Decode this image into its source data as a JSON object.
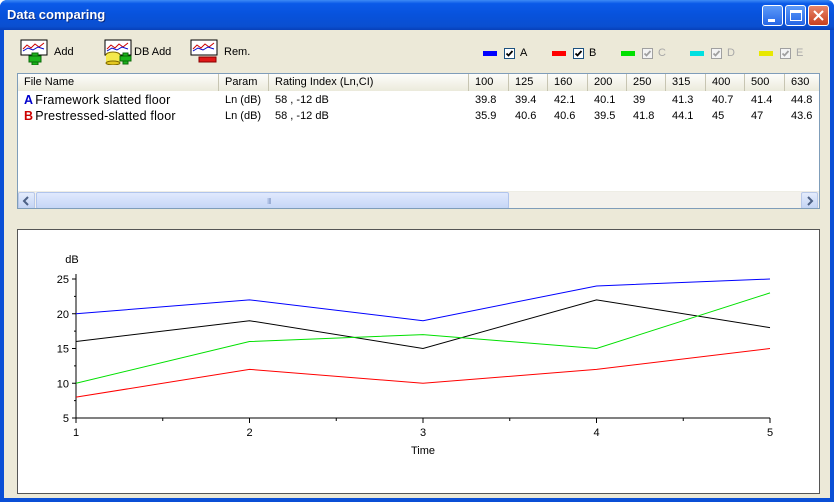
{
  "window": {
    "title": "Data comparing"
  },
  "toolbar": {
    "add_label": "Add",
    "db_add_label": "DB Add",
    "rem_label": "Rem."
  },
  "legend": [
    {
      "letter": "A",
      "color": "#0000ff",
      "checked": true,
      "enabled": true
    },
    {
      "letter": "B",
      "color": "#ff0000",
      "checked": true,
      "enabled": true
    },
    {
      "letter": "C",
      "color": "#00e000",
      "checked": true,
      "enabled": false
    },
    {
      "letter": "D",
      "color": "#00e0e0",
      "checked": true,
      "enabled": false
    },
    {
      "letter": "E",
      "color": "#e8e800",
      "checked": true,
      "enabled": false
    }
  ],
  "table": {
    "columns": [
      "File Name",
      "Param",
      "Rating Index (Ln,CI)",
      "100",
      "125",
      "160",
      "200",
      "250",
      "315",
      "400",
      "500",
      "630"
    ],
    "rows": [
      {
        "letter": "A",
        "letter_color": "#0000cc",
        "name": "Framework slatted floor",
        "param": "Ln (dB)",
        "rating": "58 , -12 dB",
        "values": [
          "39.8",
          "39.4",
          "42.1",
          "40.1",
          "39",
          "41.3",
          "40.7",
          "41.4",
          "44.8"
        ]
      },
      {
        "letter": "B",
        "letter_color": "#cc0000",
        "name": "Prestressed-slatted floor",
        "param": "Ln (dB)",
        "rating": "58 , -12 dB",
        "values": [
          "35.9",
          "40.6",
          "40.6",
          "39.5",
          "41.8",
          "44.1",
          "45",
          "47",
          "43.6"
        ]
      }
    ],
    "scroll_grip": "III"
  },
  "chart_data": {
    "type": "line",
    "title": "",
    "xlabel": "Time",
    "ylabel": "dB",
    "x": [
      1,
      2,
      3,
      4,
      5
    ],
    "xlim": [
      1,
      5
    ],
    "ylim": [
      5,
      25
    ],
    "xticks": [
      1,
      2,
      3,
      4,
      5
    ],
    "yticks": [
      5,
      10,
      15,
      20,
      25
    ],
    "grid": false,
    "series": [
      {
        "color": "#0000ff",
        "values": [
          20,
          22,
          19,
          24,
          25
        ]
      },
      {
        "color": "#000000",
        "values": [
          16,
          19,
          15,
          22,
          18
        ]
      },
      {
        "color": "#00e000",
        "values": [
          10,
          16,
          17,
          15,
          23
        ]
      },
      {
        "color": "#ff0000",
        "values": [
          8,
          12,
          10,
          12,
          15
        ]
      }
    ]
  }
}
